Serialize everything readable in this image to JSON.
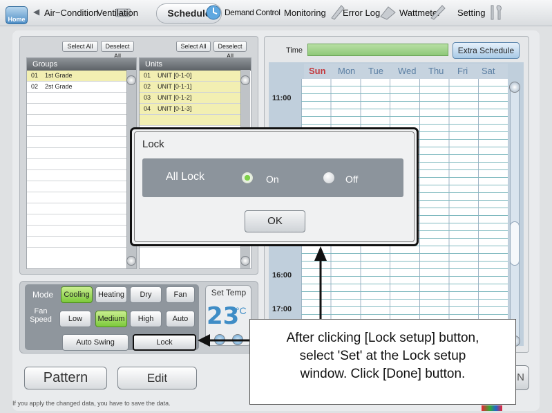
{
  "nav": {
    "home": "Home",
    "tabs": [
      "Air−Condition",
      "Ventilation",
      "Schedule",
      "Demand Control",
      "Monitoring",
      "Error Log",
      "Wattmeter",
      "Setting"
    ]
  },
  "groups": {
    "select_all": "Select All",
    "deselect_all": "Deselect All",
    "header": "Groups",
    "items": [
      {
        "num": "01",
        "name": "1st Grade"
      },
      {
        "num": "02",
        "name": "2st Grade"
      }
    ]
  },
  "units": {
    "select_all": "Select All",
    "deselect_all": "Deselect All",
    "header": "Units",
    "items": [
      {
        "num": "01",
        "name": "UNIT [0-1-0]"
      },
      {
        "num": "02",
        "name": "UNIT [0-1-1]"
      },
      {
        "num": "03",
        "name": "UNIT [0-1-2]"
      },
      {
        "num": "04",
        "name": "UNIT [0-1-3]"
      }
    ]
  },
  "controls": {
    "mode_label": "Mode",
    "modes": [
      "Cooling",
      "Heating",
      "Dry",
      "Fan"
    ],
    "mode_selected": "Cooling",
    "fan_label": "Fan Speed",
    "speeds": [
      "Low",
      "Medium",
      "High",
      "Auto"
    ],
    "speed_selected": "Medium",
    "auto_swing": "Auto Swing",
    "lock": "Lock",
    "set_temp_label": "Set Temp",
    "set_temp_value": "23",
    "set_temp_unit": "°C"
  },
  "schedule": {
    "time_label": "Time",
    "extra_schedule": "Extra Schedule",
    "days": [
      "Sun",
      "Mon",
      "Tue",
      "Wed",
      "Thu",
      "Fri",
      "Sat"
    ],
    "hours": [
      "11:00",
      "16:00",
      "17:00"
    ]
  },
  "bottom": {
    "pattern": "Pattern",
    "edit": "Edit",
    "save_notice": "If you apply the changed data, you have to save the data."
  },
  "dialog": {
    "title": "Lock",
    "all_lock": "All Lock",
    "on": "On",
    "off": "Off",
    "selected": "On",
    "ok": "OK"
  },
  "callout": {
    "line1": "After clicking [Lock setup] button,",
    "line2": "select 'Set' at the Lock setup",
    "line3": "window. Click [Done] button."
  },
  "colors": {
    "selected_row": "#f2efb2",
    "active_button": "#7cc93b",
    "temp_value": "#3f8dc6"
  }
}
